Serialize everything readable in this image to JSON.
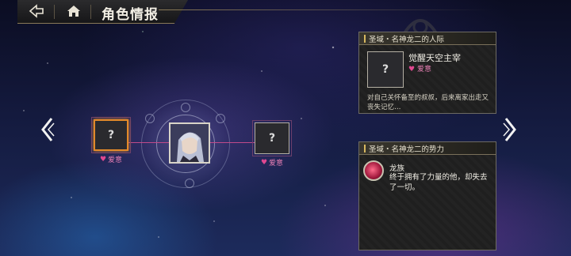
{
  "header": {
    "title": "角色情报",
    "back_icon": "back-arrow-icon",
    "home_icon": "home-icon"
  },
  "diagram": {
    "center": {
      "portrait": "character-portrait"
    },
    "left_node": {
      "symbol": "?",
      "relation": "爱意",
      "selected": true
    },
    "right_node": {
      "symbol": "?",
      "relation": "爱意",
      "selected": false
    }
  },
  "nav": {
    "prev_icon": "chevron-left-icon",
    "next_icon": "chevron-right-icon"
  },
  "relations_panel": {
    "header": "圣域・名神龙二的人际",
    "item": {
      "symbol": "?",
      "name": "觉醒天空主宰",
      "relation": "爱意",
      "description": "对自己关怀备至的叔叔，后来离家出走又丧失记忆…"
    }
  },
  "faction_panel": {
    "header": "圣域・名神龙二的势力",
    "item": {
      "name": "龙族",
      "description": "终于拥有了力量的他，却失去了一切。"
    }
  },
  "colors": {
    "accent_selected": "#e28a2a",
    "affection": "#e87fb4",
    "connector": "#c04a8a",
    "panel_border": "#6d6a62"
  }
}
